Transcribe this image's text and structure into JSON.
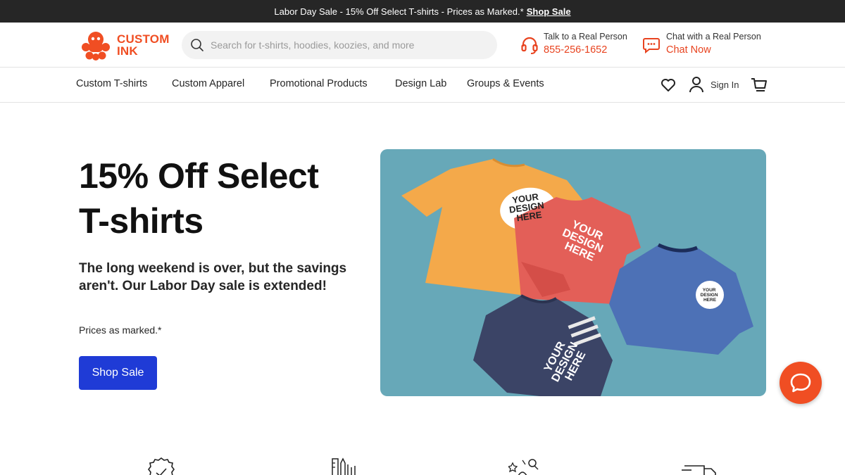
{
  "promo": {
    "text": "Labor Day Sale - 15% Off Select T-shirts - Prices as Marked.*",
    "link": "Shop Sale"
  },
  "header": {
    "logo_line1": "CUSTOM",
    "logo_line2": "INK",
    "search_placeholder": "Search for t-shirts, hoodies, koozies, and more",
    "phone_label": "Talk to a Real Person",
    "phone_number": "855-256-1652",
    "chat_label": "Chat with a Real Person",
    "chat_link": "Chat Now"
  },
  "nav": {
    "items": [
      "Custom T-shirts",
      "Custom Apparel",
      "Promotional Products",
      "Design Lab",
      "Groups & Events"
    ],
    "sign_in": "Sign In"
  },
  "hero": {
    "title_line1": "15% Off Select",
    "title_line2": "T-shirts",
    "subtitle": "The long weekend is over, but the savings aren't. Our Labor Day sale is extended!",
    "note": "Prices as marked.*",
    "cta": "Shop Sale",
    "print_text": [
      "YOUR",
      "DESIGN",
      "HERE"
    ]
  },
  "colors": {
    "brand": "#f04e23",
    "cta": "#1f3bd6",
    "promo_bg": "#262626",
    "hero_bg": "#67a8b8"
  },
  "icons": [
    "search-icon",
    "headset-icon",
    "chat-icon",
    "heart-icon",
    "user-icon",
    "cart-icon",
    "chat-fab-icon",
    "badge-check-icon",
    "pencil-ruler-icon",
    "design-tools-icon",
    "delivery-truck-icon"
  ]
}
